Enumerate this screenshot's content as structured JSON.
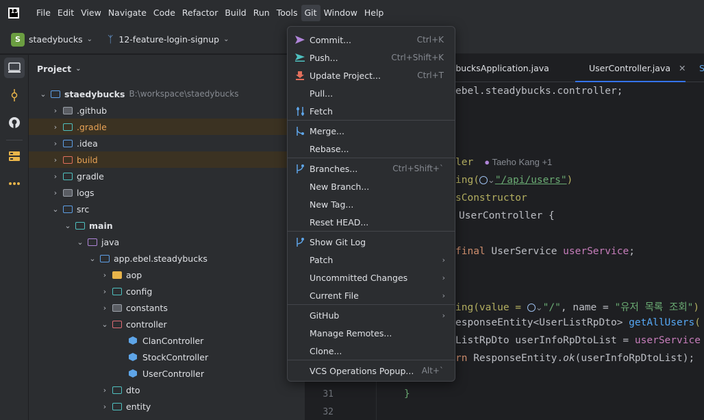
{
  "menubar": {
    "items": [
      "File",
      "Edit",
      "View",
      "Navigate",
      "Code",
      "Refactor",
      "Build",
      "Run",
      "Tools",
      "Git",
      "Window",
      "Help"
    ],
    "active_index": 9
  },
  "toolbar": {
    "project_badge": "S",
    "project_name": "staedybucks",
    "branch": "12-feature-login-signup"
  },
  "project_panel": {
    "title": "Project",
    "root_name": "staedybucks",
    "root_path": "B:\\workspace\\staedybucks",
    "tree": [
      {
        "label": ".github"
      },
      {
        "label": ".gradle"
      },
      {
        "label": ".idea"
      },
      {
        "label": "build"
      },
      {
        "label": "gradle"
      },
      {
        "label": "logs"
      },
      {
        "label": "src"
      },
      {
        "label": "main"
      },
      {
        "label": "java"
      },
      {
        "label": "app.ebel.steadybucks"
      },
      {
        "label": "aop"
      },
      {
        "label": "config"
      },
      {
        "label": "constants"
      },
      {
        "label": "controller"
      },
      {
        "label": "ClanController"
      },
      {
        "label": "StockController"
      },
      {
        "label": "UserController"
      },
      {
        "label": "dto"
      },
      {
        "label": "entity"
      }
    ]
  },
  "editor": {
    "tabs": [
      {
        "label": "dybucksApplication.java"
      },
      {
        "label": "UserController.java"
      },
      {
        "label": "S"
      }
    ],
    "line_numbers": [
      "31",
      "32"
    ],
    "code": {
      "l1": "ebel.steadybucks.controller;",
      "l2_kw": "ler",
      "l2_hint": "Taeho Kang +1",
      "l3_a": "ing(",
      "l3_str": "\"/api/users\"",
      "l3_b": ")",
      "l4": "sConstructor",
      "l5_b": "UserController {",
      "l6_kw": "final",
      "l6_type": "UserService",
      "l6_fld": "userService",
      "l6_end": ";",
      "l7_a": "ing(value = ",
      "l7_str": "\"/\"",
      "l7_b": ", name = ",
      "l7_str2": "\"유저 목록 조회\"",
      "l7_c": ")",
      "l8_a": "esponseEntity<UserListRpDto>",
      "l8_fn": "getAllUsers",
      "l8_b": "(",
      "l9_a": "ListRpDto userInfoRpDtoList = ",
      "l9_fld": "userService",
      "l10_kw": "rn",
      "l10_a": " ResponseEntity.",
      "l10_it": "ok",
      "l10_b": "(userInfoRpDtoList);",
      "l11": "}"
    }
  },
  "git_menu": {
    "items": [
      {
        "label": "Commit...",
        "shortcut": "Ctrl+K",
        "icon": "commit-icon"
      },
      {
        "label": "Push...",
        "shortcut": "Ctrl+Shift+K",
        "icon": "push-icon"
      },
      {
        "label": "Update Project...",
        "shortcut": "Ctrl+T",
        "icon": "update-icon"
      },
      {
        "label": "Pull...",
        "shortcut": ""
      },
      {
        "label": "Fetch",
        "shortcut": "",
        "icon": "fetch-icon"
      },
      {
        "label": "Merge...",
        "shortcut": "",
        "icon": "merge-icon"
      },
      {
        "label": "Rebase...",
        "shortcut": ""
      },
      {
        "label": "Branches...",
        "shortcut": "Ctrl+Shift+`",
        "icon": "branch-icon"
      },
      {
        "label": "New Branch...",
        "shortcut": ""
      },
      {
        "label": "New Tag...",
        "shortcut": ""
      },
      {
        "label": "Reset HEAD...",
        "shortcut": ""
      },
      {
        "label": "Show Git Log",
        "shortcut": "",
        "icon": "git-log-icon"
      },
      {
        "label": "Patch",
        "submenu": true
      },
      {
        "label": "Uncommitted Changes",
        "submenu": true
      },
      {
        "label": "Current File",
        "submenu": true
      },
      {
        "label": "GitHub",
        "submenu": true
      },
      {
        "label": "Manage Remotes...",
        "shortcut": ""
      },
      {
        "label": "Clone...",
        "shortcut": ""
      },
      {
        "label": "VCS Operations Popup...",
        "shortcut": "Alt+`"
      }
    ]
  }
}
